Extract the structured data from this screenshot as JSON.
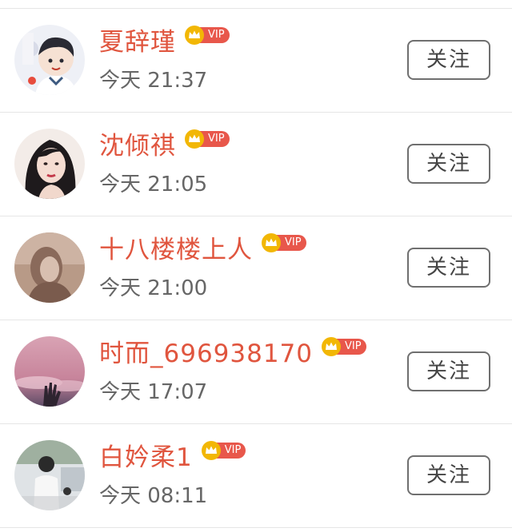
{
  "follow_list": [
    {
      "name": "夏辞瑾",
      "vip_label": "VIP",
      "time": "今天 21:37",
      "follow_label": "关注"
    },
    {
      "name": "沈倾祺",
      "vip_label": "VIP",
      "time": "今天 21:05",
      "follow_label": "关注"
    },
    {
      "name": "十八楼楼上人",
      "vip_label": "VIP",
      "time": "今天 21:00",
      "follow_label": "关注"
    },
    {
      "name": "时而_696938170",
      "vip_label": "VIP",
      "time": "今天 17:07",
      "follow_label": "关注"
    },
    {
      "name": "白妗柔1",
      "vip_label": "VIP",
      "time": "今天 08:11",
      "follow_label": "关注"
    }
  ],
  "colors": {
    "name": "#e0553e",
    "vip_badge": "#e8574b",
    "crown": "#f2b705",
    "time": "#666666",
    "button_border": "#6f6f6f"
  }
}
